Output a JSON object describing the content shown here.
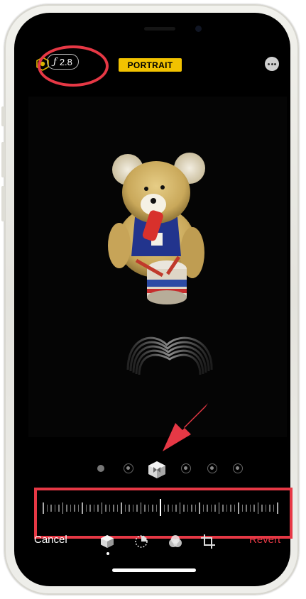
{
  "top_bar": {
    "aperture_symbol": "ƒ",
    "aperture_value": "2.8",
    "mode_badge": "PORTRAIT",
    "mode_badge_color": "#f2c200"
  },
  "icons": {
    "lighting": "hexagon-lighting-icon",
    "more": "more-options-icon",
    "effect_selected": "high-key-mono-cube-icon",
    "portrait_tool": "cube-portrait-tool-icon",
    "adjust_tool": "adjust-dial-icon",
    "filters_tool": "filters-circles-icon",
    "crop_tool": "crop-rotate-icon"
  },
  "bottom_bar": {
    "cancel_label": "Cancel",
    "revert_label": "Revert",
    "revert_color": "#e63845"
  },
  "annotations": {
    "highlight_color": "#e63845"
  }
}
